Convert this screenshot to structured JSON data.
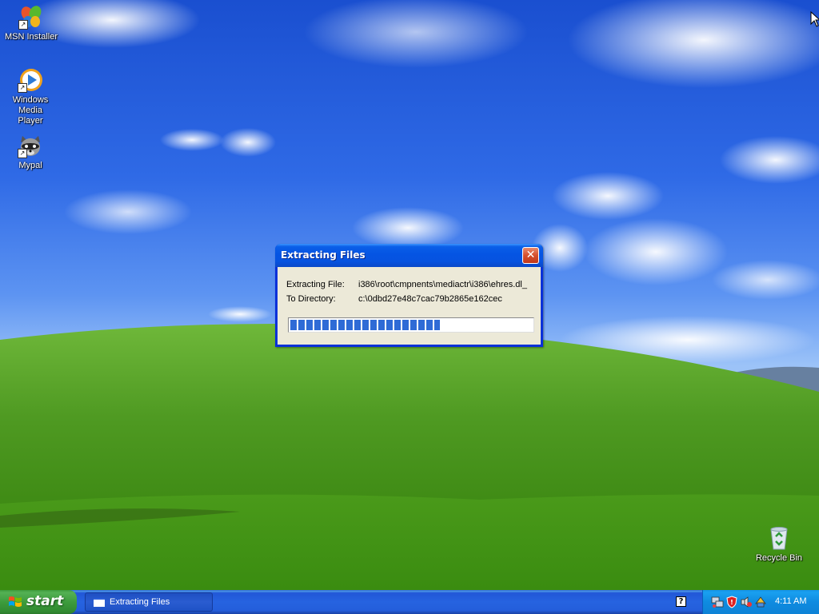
{
  "desktop": {
    "icons": [
      {
        "label": "MSN Installer",
        "icon": "msn-butterfly-icon"
      },
      {
        "label": "Windows Media Player",
        "label_line1": "Windows Media",
        "label_line2": "Player",
        "icon": "media-player-icon"
      },
      {
        "label": "Mypal",
        "icon": "mypal-raccoon-icon"
      },
      {
        "label": "Recycle Bin",
        "icon": "recycle-bin-icon"
      }
    ]
  },
  "dialog": {
    "title": "Extracting Files",
    "file_label": "Extracting File:",
    "file_value": "i386\\root\\cmpnents\\mediactr\\i386\\ehres.dl_",
    "dir_label": "To Directory:",
    "dir_value": "c:\\0dbd27e48c7cac79b2865e162cec",
    "progress_fraction": 0.62
  },
  "taskbar": {
    "start_label": "start",
    "tasks": [
      {
        "label": "Extracting Files"
      }
    ],
    "tray_icons": [
      "network-icon",
      "security-shield-icon",
      "volume-icon",
      "update-icon"
    ],
    "clock": "4:11 AM",
    "help": "?"
  },
  "colors": {
    "titlebar": "#0554e3",
    "dialog_face": "#ece9d8",
    "progress_fill": "#2f6bd6",
    "taskbar": "#245edb",
    "start_button": "#3d9c3d"
  }
}
